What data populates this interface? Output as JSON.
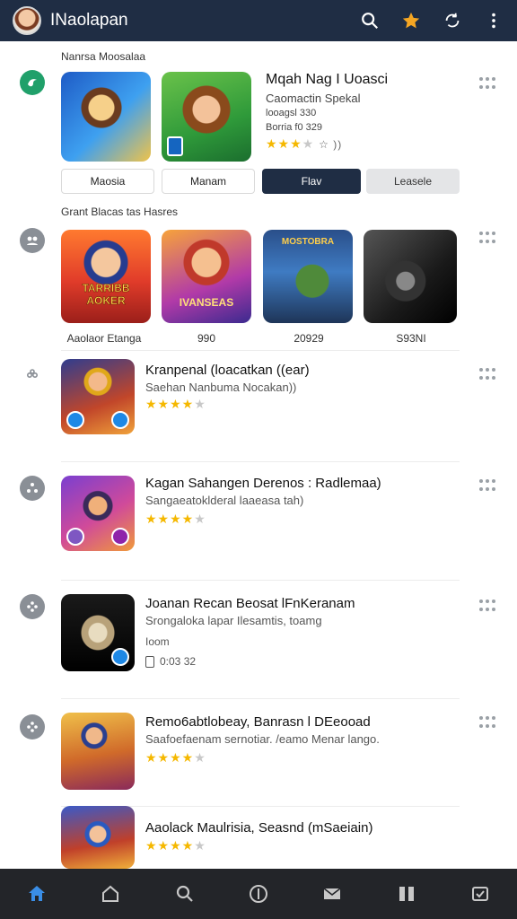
{
  "header": {
    "title": "INaolapan"
  },
  "featured": {
    "section_label": "Nanrsa Moosalaa",
    "title": "Mqah Nag I Uoasci",
    "line1": "Caomactin Spekal",
    "line2": "looagsl 330",
    "line3": "Borria f0 329",
    "rating_text": "☆ ))",
    "chips": [
      "Maosia",
      "Manam",
      "Flav",
      "Leasele"
    ]
  },
  "games": {
    "section_label": "Grant Blacas tas Hasres",
    "items": [
      {
        "caption": "Aaolaor Etanga",
        "art": "TARRIBB AOKER"
      },
      {
        "caption": "990",
        "art": "IVANSEAS"
      },
      {
        "caption": "20929",
        "art": "MOSTOBRA"
      },
      {
        "caption": "S93NI",
        "art": ""
      }
    ]
  },
  "list": [
    {
      "title": "Kranpenal (loacatkan ((ear)",
      "subtitle": "Saehan Nanbuma Nocakan))",
      "rating": 4
    },
    {
      "title": "Kagan Sahangen Derenos : Radlemaa)",
      "subtitle": "Sangaeatoklderal laaeasa tah)",
      "rating": 4
    },
    {
      "title": "Joanan Recan Beosat lFnKeranam",
      "subtitle": "Srongaloka lapar Ilesamtis, toamg",
      "line3": "Ioom",
      "extra": "0:03 32",
      "rating": 0
    },
    {
      "title": "Remo6abtlobeay, Banrasn l DEeooad",
      "subtitle": "Saafoefaenam sernotiar. /eamo Menar lango.",
      "rating": 4
    },
    {
      "title": "Aaolack Maulrisia, Seasnd (mSaeiain)",
      "subtitle": "",
      "rating": 4
    }
  ],
  "nav": [
    "home-icon",
    "house-outline-icon",
    "search-icon",
    "info-icon",
    "mail-icon",
    "grid-icon",
    "inbox-icon"
  ],
  "colors": {
    "topbar": "#1f2d44",
    "bottomnav": "#232529",
    "accent_star": "#f5b800",
    "active_nav": "#3a8ee6"
  }
}
